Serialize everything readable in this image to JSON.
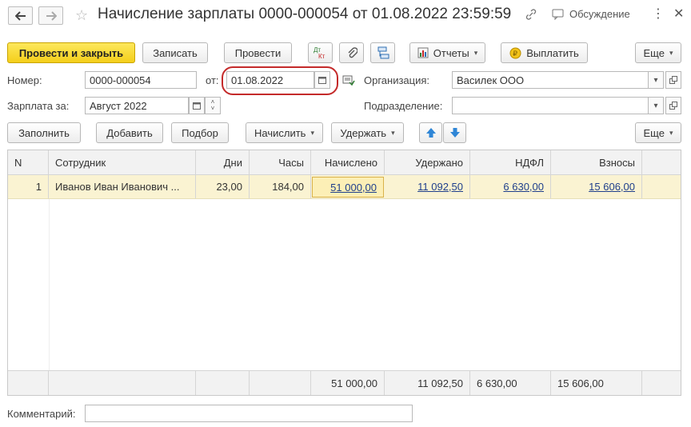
{
  "window": {
    "title": "Начисление зарплаты 0000-000054 от 01.08.2022 23:59:59",
    "discussion_label": "Обсуждение"
  },
  "toolbar": {
    "post_close": "Провести и закрыть",
    "save": "Записать",
    "post": "Провести",
    "dtkt": "Дт Кт",
    "reports": "Отчеты",
    "pay": "Выплатить",
    "more": "Еще"
  },
  "form": {
    "number_label": "Номер:",
    "number_value": "0000-000054",
    "date_label": "от:",
    "date_value": "01.08.2022",
    "org_label": "Организация:",
    "org_value": "Василек ООО",
    "period_label": "Зарплата за:",
    "period_value": "Август 2022",
    "division_label": "Подразделение:",
    "division_value": ""
  },
  "table_toolbar": {
    "fill": "Заполнить",
    "add": "Добавить",
    "select": "Подбор",
    "accrue": "Начислить",
    "withhold": "Удержать",
    "more": "Еще"
  },
  "table": {
    "headers": [
      "N",
      "Сотрудник",
      "Дни",
      "Часы",
      "Начислено",
      "Удержано",
      "НДФЛ",
      "Взносы"
    ],
    "rows": [
      {
        "n": "1",
        "employee": "Иванов Иван Иванович ...",
        "days": "23,00",
        "hours": "184,00",
        "accrued": "51 000,00",
        "withheld": "11 092,50",
        "ndfl": "6 630,00",
        "contributions": "15 606,00"
      }
    ],
    "totals": {
      "accrued": "51 000,00",
      "withheld": "11 092,50",
      "ndfl": "6 630,00",
      "contributions": "15 606,00"
    }
  },
  "comment": {
    "label": "Комментарий:",
    "value": ""
  },
  "colors": {
    "primary_button": "#f4ce1b",
    "highlight_oval": "#c42a2a",
    "selected_row": "#faf3d2",
    "link": "#1f3f8c",
    "arrow_blue": "#2f86d6"
  }
}
